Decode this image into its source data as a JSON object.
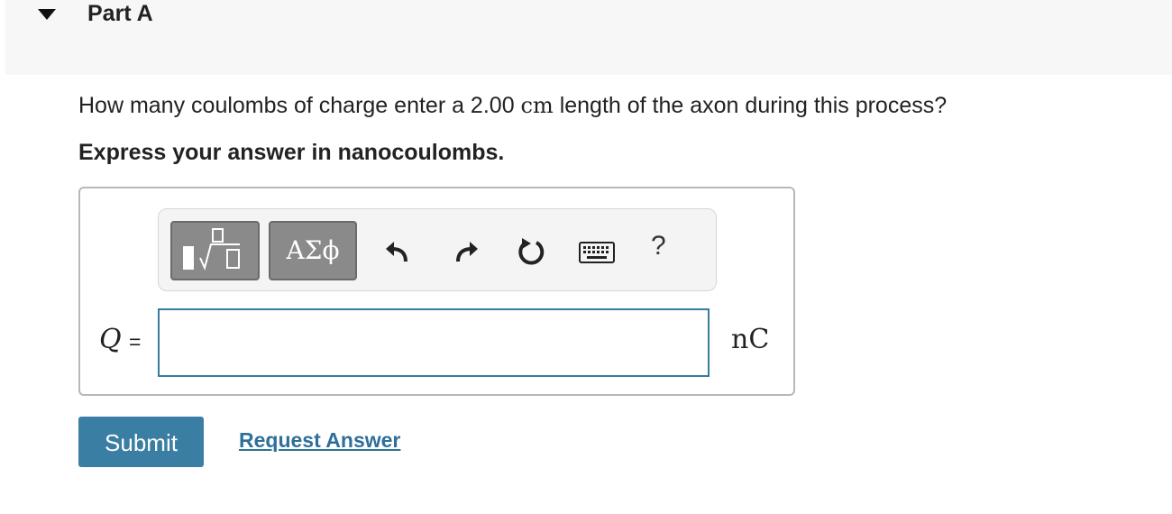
{
  "part": {
    "title": "Part A",
    "expanded_icon": "triangle-down-icon"
  },
  "question": {
    "text_before": "How many coulombs of charge enter a 2.00 ",
    "unit": "cm",
    "text_after": " length of the axon during this process?"
  },
  "instruction": "Express your answer in nanocoulombs.",
  "toolbar": {
    "templates_icon": "templates-sqrt-icon",
    "symbols_label": "ΑΣϕ",
    "undo_icon": "undo-icon",
    "redo_icon": "redo-icon",
    "reset_icon": "reset-icon",
    "keyboard_icon": "keyboard-icon",
    "help_label": "?"
  },
  "answer": {
    "variable": "Q",
    "equals": "=",
    "value": "",
    "unit": "nC"
  },
  "actions": {
    "submit_label": "Submit",
    "request_answer_label": "Request Answer"
  },
  "colors": {
    "submit_bg": "#3a7ea3",
    "link": "#2f6f99",
    "input_border": "#3a7a9a",
    "toolbar_button": "#8a8a8a"
  }
}
